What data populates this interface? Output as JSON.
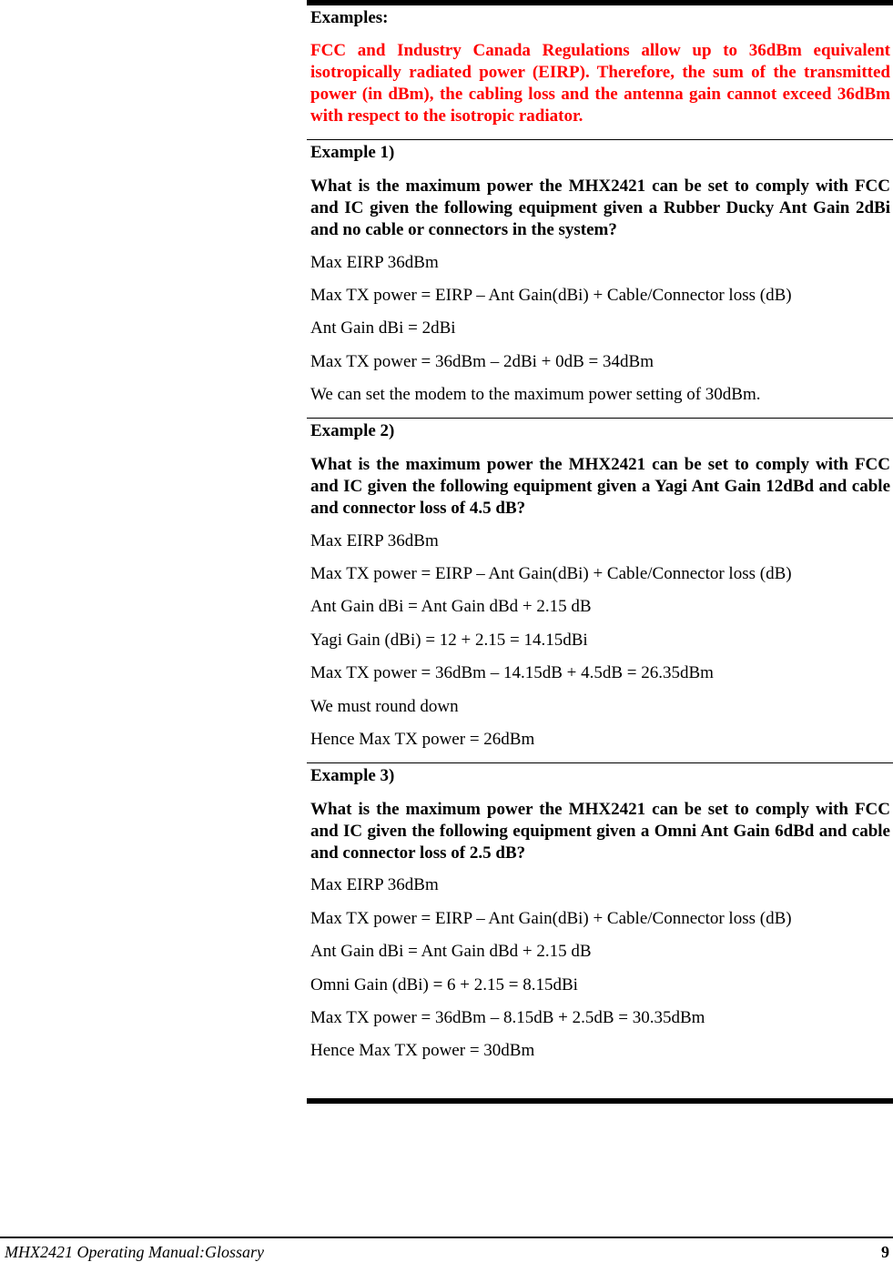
{
  "intro": {
    "heading": "Examples:",
    "notice": "FCC and Industry Canada Regulations allow up to 36dBm equivalent isotropically radiated power (EIRP).  Therefore, the sum of the transmitted power (in dBm), the cabling loss and the antenna gain cannot exceed 36dBm with respect to the isotropic radiator.",
    "notice_color": "#ff0000"
  },
  "examples": [
    {
      "title": "Example 1)",
      "question": "What is the maximum power the MHX2421 can be set to comply with FCC and IC given the following equipment given a Rubber Ducky Ant Gain 2dBi and no cable or connectors in the system?",
      "lines": [
        "Max EIRP 36dBm",
        "Max TX power = EIRP – Ant Gain(dBi) + Cable/Connector loss (dB)",
        "Ant Gain dBi = 2dBi",
        "Max TX power = 36dBm  – 2dBi  + 0dB = 34dBm",
        "We can set the modem to the maximum power setting of 30dBm."
      ]
    },
    {
      "title": "Example 2)",
      "question": "What is the maximum power the MHX2421 can be set to comply with FCC and IC given the following equipment given a Yagi Ant Gain 12dBd and cable and connector loss of 4.5 dB?",
      "lines": [
        "Max EIRP 36dBm",
        "Max TX power = EIRP – Ant Gain(dBi) + Cable/Connector loss (dB)",
        "Ant Gain dBi = Ant Gain dBd + 2.15  dB",
        "Yagi Gain (dBi) = 12 + 2.15 = 14.15dBi",
        "Max TX power = 36dBm  – 14.15dB  + 4.5dB = 26.35dBm",
        "We must round down",
        "Hence Max TX power = 26dBm"
      ]
    },
    {
      "title": "Example 3)",
      "question": "What is the maximum power the MHX2421 can be set to comply with FCC and IC given the following equipment given a Omni Ant Gain 6dBd and cable and connector loss of 2.5 dB?",
      "lines": [
        "Max EIRP 36dBm",
        "Max TX power = EIRP – Ant Gain(dBi) + Cable/Connector loss (dB)",
        "Ant Gain dBi = Ant Gain dBd + 2.15 dB",
        "Omni Gain (dBi) = 6 + 2.15 = 8.15dBi",
        "Max TX power = 36dBm  – 8.15dB  + 2.5dB = 30.35dBm",
        "Hence Max TX power = 30dBm"
      ]
    }
  ],
  "footer": {
    "document_title": "MHX2421 Operating Manual:Glossary",
    "page_number": "9"
  }
}
